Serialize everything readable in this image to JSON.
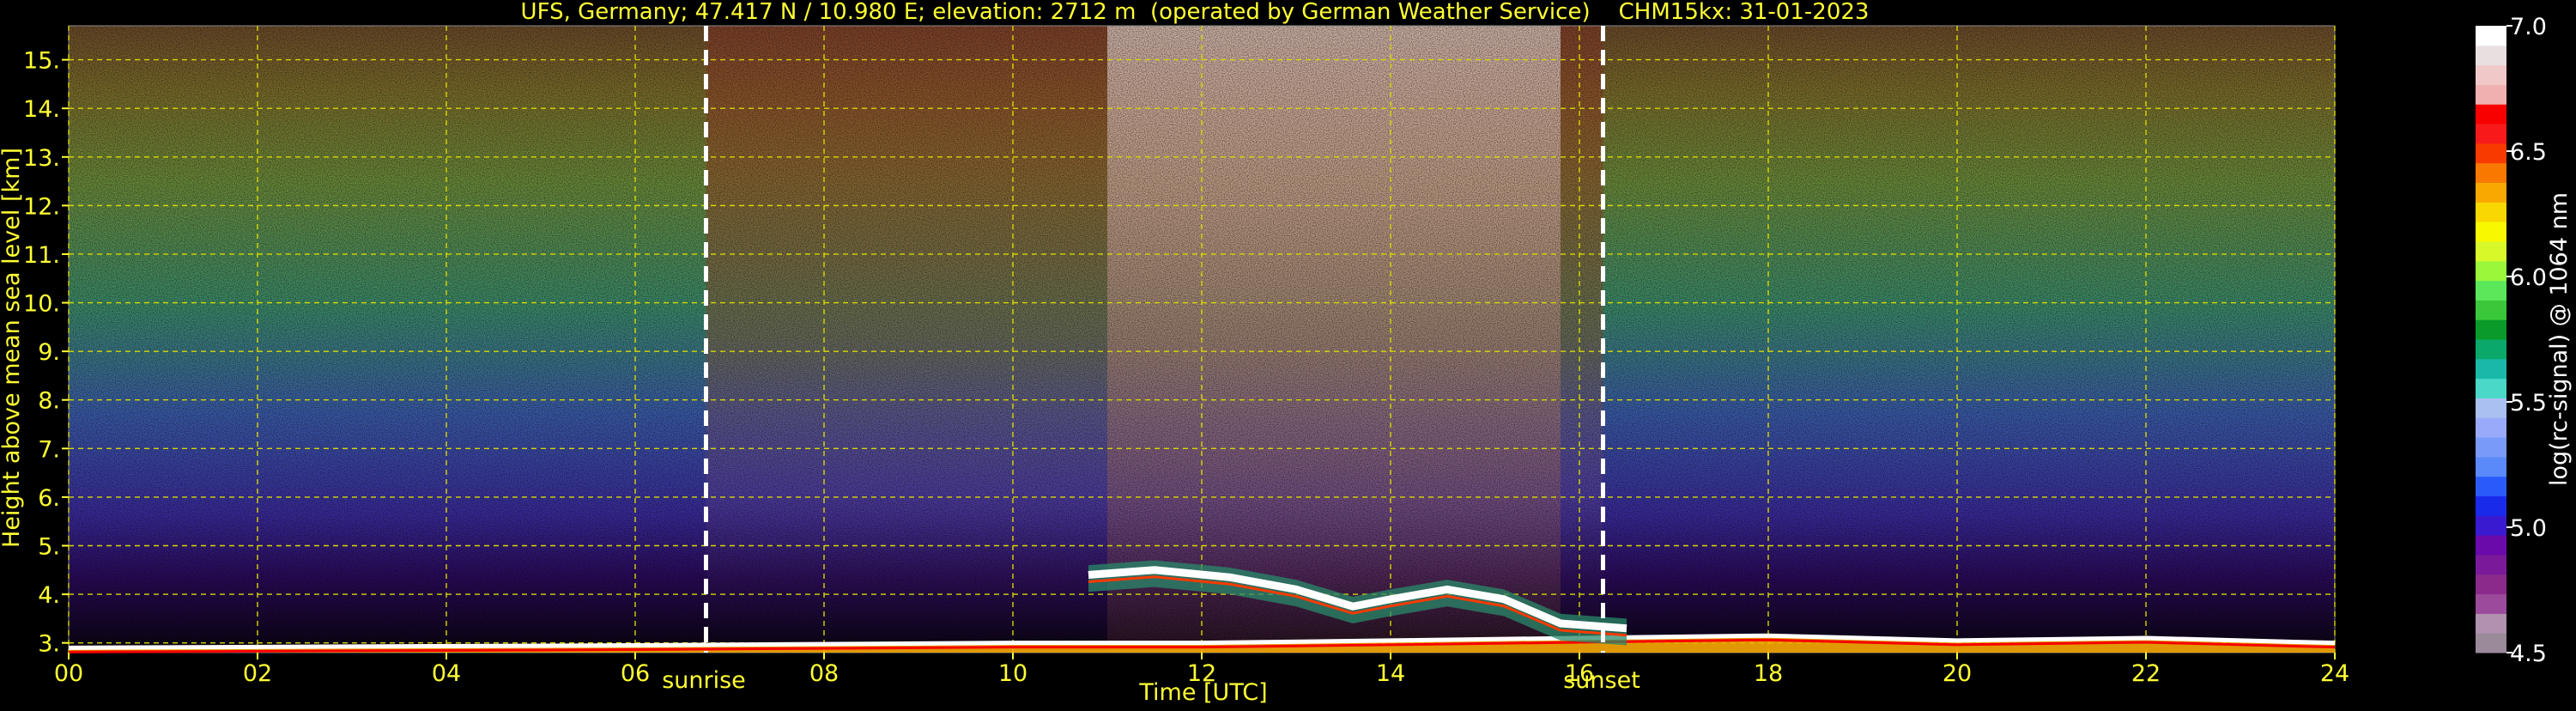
{
  "title": "UFS, Germany; 47.417 N / 10.980 E; elevation: 2712 m  (operated by German Weather Service)    CHM15kx: 31-01-2023",
  "colors": {
    "background": "#000000",
    "text_yellow": "#ffff33",
    "grid": "#d8d800",
    "text_white": "#ffffff"
  },
  "annotations": {
    "sunrise_label": "sunrise",
    "sunset_label": "sunset",
    "sunrise_time": 6.75,
    "sunset_time": 16.25
  },
  "chart_data": {
    "type": "heatmap",
    "title": "UFS, Germany; 47.417 N / 10.980 E; elevation: 2712 m  (operated by German Weather Service)    CHM15kx: 31-01-2023",
    "xlabel": "Time [UTC]",
    "ylabel": "Height above mean sea level [km]",
    "xlim": [
      0,
      24
    ],
    "ylim": [
      2.8,
      15.7
    ],
    "x_ticks": [
      "00",
      "02",
      "04",
      "06",
      "08",
      "10",
      "12",
      "14",
      "16",
      "18",
      "20",
      "22",
      "24"
    ],
    "y_ticks": [
      "3.",
      "4.",
      "5.",
      "6.",
      "7.",
      "8.",
      "9.",
      "10.",
      "11.",
      "12.",
      "13.",
      "14.",
      "15."
    ],
    "grid": true,
    "colorbar": {
      "label": "log(rc-signal) @ 1064 nm",
      "range": [
        4.5,
        7.0
      ],
      "ticks": [
        "4.5",
        "5.0",
        "5.5",
        "6.0",
        "6.5",
        "7.0"
      ],
      "colors": [
        "#9a8a9a",
        "#b092b0",
        "#9c4a9c",
        "#8a2a8a",
        "#7a1a9a",
        "#6a0aaa",
        "#3a1ad0",
        "#1a2aea",
        "#2a5afa",
        "#5a8afa",
        "#7a9afa",
        "#9aaafa",
        "#aac0f0",
        "#4ad8c8",
        "#1ab8a8",
        "#0aa86a",
        "#0a9a2a",
        "#3ac83a",
        "#5ae85a",
        "#9af83a",
        "#d8f82a",
        "#f8f800",
        "#f8d800",
        "#f8a800",
        "#f87800",
        "#f83a00",
        "#f81a1a",
        "#f80000",
        "#f0b0b0",
        "#f0c8c8",
        "#e8e0e0",
        "#ffffff"
      ]
    },
    "layers": [
      {
        "name": "surface",
        "points": [
          [
            0,
            2.9
          ],
          [
            6,
            2.95
          ],
          [
            10,
            3.0
          ],
          [
            12,
            3.0
          ],
          [
            14,
            3.05
          ],
          [
            16,
            3.1
          ],
          [
            18,
            3.15
          ],
          [
            20,
            3.05
          ],
          [
            22,
            3.1
          ],
          [
            24,
            3.0
          ]
        ]
      },
      {
        "name": "cloud_layer",
        "points": [
          [
            10.8,
            4.4
          ],
          [
            11.5,
            4.5
          ],
          [
            12.3,
            4.35
          ],
          [
            13.0,
            4.1
          ],
          [
            13.6,
            3.75
          ],
          [
            14.0,
            3.9
          ],
          [
            14.6,
            4.1
          ],
          [
            15.2,
            3.9
          ],
          [
            15.8,
            3.4
          ],
          [
            16.5,
            3.3
          ]
        ]
      }
    ]
  }
}
